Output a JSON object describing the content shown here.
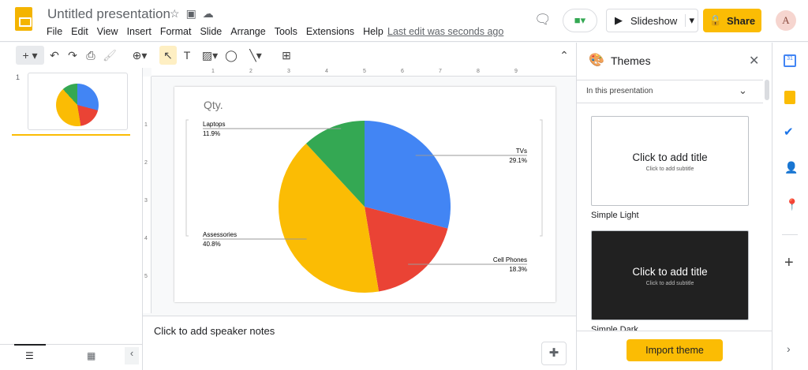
{
  "app": {
    "title": "Untitled presentation",
    "menu": [
      "File",
      "Edit",
      "View",
      "Insert",
      "Format",
      "Slide",
      "Arrange",
      "Tools",
      "Extensions",
      "Help"
    ],
    "last_edit": "Last edit was seconds ago",
    "slideshow": "Slideshow",
    "share": "Share",
    "avatar": "A"
  },
  "filmstrip": {
    "slide_number": "1"
  },
  "notes": {
    "placeholder": "Click to add speaker notes"
  },
  "ruler": {
    "h": [
      "1",
      "2",
      "3",
      "4",
      "5",
      "6",
      "7",
      "8",
      "9"
    ],
    "v": [
      "1",
      "2",
      "3",
      "4",
      "5"
    ]
  },
  "themes": {
    "title": "Themes",
    "section": "In this presentation",
    "cards": [
      {
        "name": "Simple Light",
        "title": "Click to add title",
        "subtitle": "Click to add subtitle"
      },
      {
        "name": "Simple Dark",
        "title": "Click to add title",
        "subtitle": "Click to add subtitle"
      }
    ],
    "import": "Import theme"
  },
  "colors": {
    "blue": "#4285f4",
    "red": "#ea4335",
    "yellow": "#fbbc04",
    "green": "#34a853"
  },
  "chart_data": {
    "type": "pie",
    "title": "Qty.",
    "categories": [
      "TVs",
      "Cell Phones",
      "Assessories",
      "Laptops"
    ],
    "values": [
      29.1,
      18.3,
      40.8,
      11.9
    ],
    "labels": [
      "29.1%",
      "18.3%",
      "40.8%",
      "11.9%"
    ],
    "colors": [
      "#4285f4",
      "#ea4335",
      "#fbbc04",
      "#34a853"
    ]
  }
}
